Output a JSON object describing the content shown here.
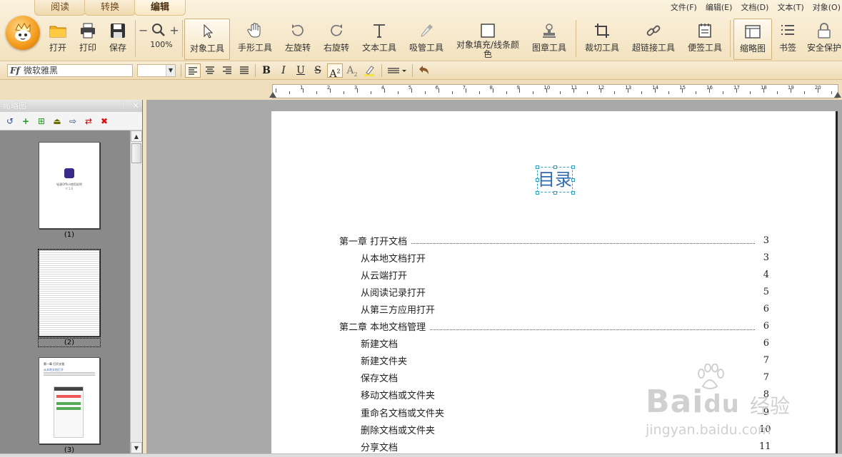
{
  "ribbon": {
    "tabs": [
      {
        "label": "阅读",
        "active": false
      },
      {
        "label": "转换",
        "active": false
      },
      {
        "label": "编辑",
        "active": true
      }
    ],
    "menus": [
      "文件(F)",
      "编辑(E)",
      "文档(D)",
      "文本(T)",
      "对象(O)"
    ],
    "buttons": {
      "open": "打开",
      "print": "打印",
      "save": "保存",
      "zoom_value": "100%",
      "object_tool": "对象工具",
      "hand_tool": "手形工具",
      "rotate_left": "左旋转",
      "rotate_right": "右旋转",
      "text_tool": "文本工具",
      "eyedropper_tool": "吸管工具",
      "fill_line_color_1": "对象填充/线条颜",
      "fill_line_color_2": "色",
      "stamp_tool": "图章工具",
      "crop_tool": "裁切工具",
      "link_tool": "超链接工具",
      "note_tool": "便签工具",
      "thumbnails": "缩略图",
      "bookmarks": "书签",
      "security": "安全保护"
    }
  },
  "format_bar": {
    "font_name": "微软雅黑",
    "font_size": ""
  },
  "ruler": {
    "ticks": [
      "1",
      "2",
      "3",
      "4",
      "5",
      "6",
      "7",
      "8",
      "9",
      "10",
      "11",
      "12",
      "13",
      "14",
      "15",
      "16",
      "17",
      "18",
      "19",
      "20"
    ]
  },
  "thumbnail_panel": {
    "title": "缩略图",
    "pages": [
      {
        "label": "(1)",
        "cover_title": "轻速Office使用说明",
        "cover_version": "V 1.0"
      },
      {
        "label": "(2)"
      },
      {
        "label": "(3)",
        "heading": "第一章 打开文档",
        "sub": "从本地文档打开"
      }
    ]
  },
  "document": {
    "toc_title": "目录",
    "toc": [
      {
        "label": "第一章  打开文档",
        "page": "3",
        "level": "chapter"
      },
      {
        "label": "从本地文档打开",
        "page": "3",
        "level": "section"
      },
      {
        "label": "从云端打开",
        "page": "4",
        "level": "section"
      },
      {
        "label": "从阅读记录打开",
        "page": "5",
        "level": "section"
      },
      {
        "label": "从第三方应用打开",
        "page": "6",
        "level": "section"
      },
      {
        "label": "第二章  本地文档管理",
        "page": "6",
        "level": "chapter"
      },
      {
        "label": "新建文档",
        "page": "6",
        "level": "section"
      },
      {
        "label": "新建文件夹",
        "page": "7",
        "level": "section"
      },
      {
        "label": "保存文档",
        "page": "7",
        "level": "section"
      },
      {
        "label": "移动文档或文件夹",
        "page": "8",
        "level": "section"
      },
      {
        "label": "重命名文档或文件夹",
        "page": "9",
        "level": "section"
      },
      {
        "label": "删除文档或文件夹",
        "page": "10",
        "level": "section"
      },
      {
        "label": "分享文档",
        "page": "11",
        "level": "section"
      }
    ]
  },
  "watermark": {
    "brand": "Bai",
    "brand2": "du",
    "cn": "经验",
    "url": "jingyan.baidu.com"
  },
  "colors": {
    "ribbon_bg": "#f3e2bf",
    "toc_title": "#2f6bb0",
    "doc_bg": "#a9a9a9",
    "thumb_bg": "#8a8a8a"
  }
}
